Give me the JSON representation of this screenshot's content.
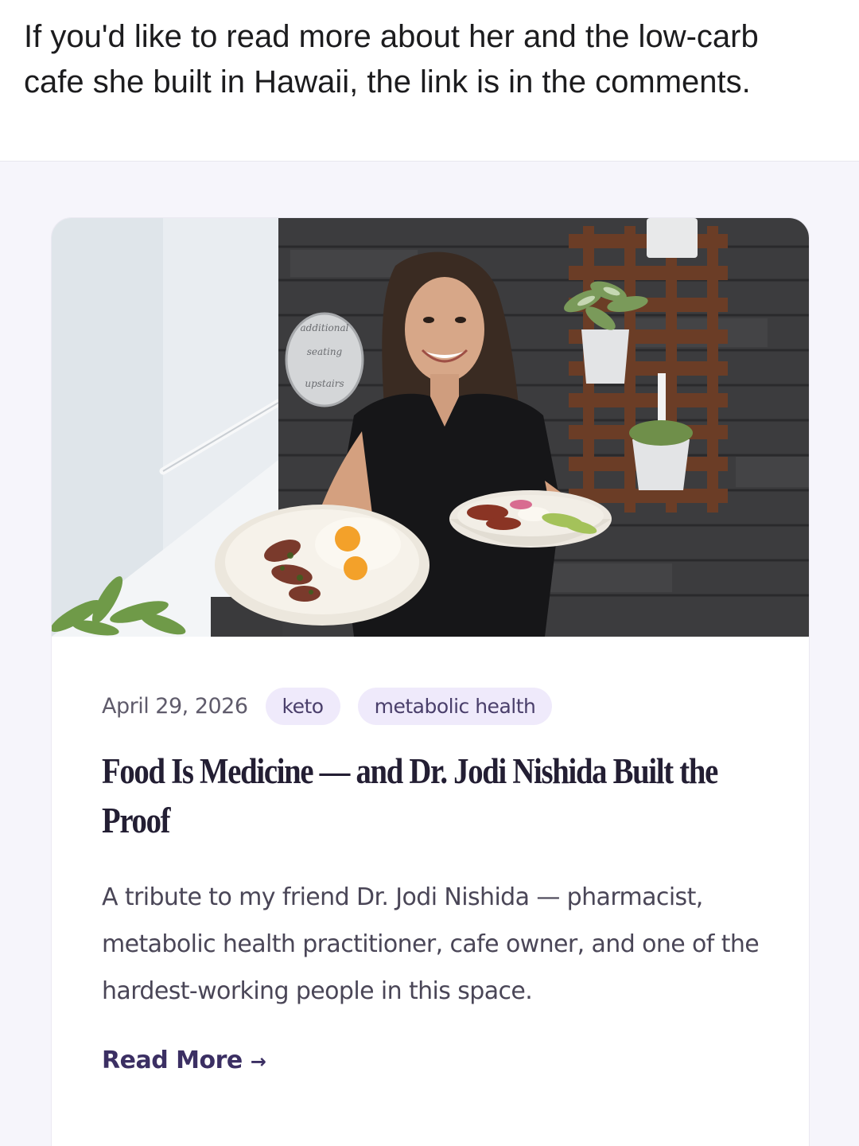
{
  "post": {
    "caption": "If you'd like to read more about her and the low-carb cafe she built in Hawaii, the link is in the comments."
  },
  "article": {
    "date": "April 29, 2026",
    "tags": [
      "keto",
      "metabolic health"
    ],
    "title": "Food Is Medicine — and Dr. Jodi Nishida Built the Proof",
    "excerpt": "A tribute to my friend Dr. Jodi Nishida — pharmacist, metabolic health practitioner, cafe owner, and one of the hardest-working people in this space.",
    "read_more": "Read More",
    "read_more_arrow": "→"
  },
  "photo": {
    "sign_lines": [
      "additional",
      "seating",
      "upstairs"
    ]
  },
  "colors": {
    "accent": "#3b2f63",
    "tag_bg": "#efeafb",
    "preview_bg": "#f6f5fb"
  }
}
